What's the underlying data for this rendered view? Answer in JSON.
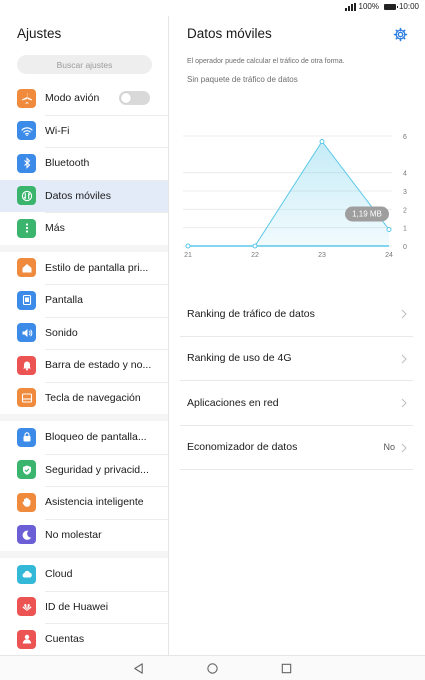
{
  "status": {
    "battery_text": "100%",
    "time": "10:00"
  },
  "left": {
    "title": "Ajustes",
    "search_placeholder": "Buscar ajustes",
    "groups": [
      [
        {
          "label": "Modo avión",
          "icon": "airplane-icon",
          "color": "#f08a3c",
          "toggle": "off"
        },
        {
          "label": "Wi-Fi",
          "icon": "wifi-icon",
          "color": "#3d8be8"
        },
        {
          "label": "Bluetooth",
          "icon": "bluetooth-icon",
          "color": "#3d8be8"
        },
        {
          "label": "Datos móviles",
          "icon": "mobile-data-icon",
          "color": "#3bb46e",
          "active": true
        },
        {
          "label": "Más",
          "icon": "more-icon",
          "color": "#3bb46e"
        }
      ],
      [
        {
          "label": "Estilo de pantalla pri...",
          "icon": "home-style-icon",
          "color": "#f08a3c"
        },
        {
          "label": "Pantalla",
          "icon": "display-icon",
          "color": "#3d8be8"
        },
        {
          "label": "Sonido",
          "icon": "sound-icon",
          "color": "#3d8be8"
        },
        {
          "label": "Barra de estado y no...",
          "icon": "notification-bell-icon",
          "color": "#ec5353"
        },
        {
          "label": "Tecla de navegación",
          "icon": "navigation-key-icon",
          "color": "#f08a3c"
        }
      ],
      [
        {
          "label": "Bloqueo de pantalla...",
          "icon": "lock-icon",
          "color": "#3d8be8"
        },
        {
          "label": "Seguridad y privacid...",
          "icon": "shield-icon",
          "color": "#3bb46e"
        },
        {
          "label": "Asistencia inteligente",
          "icon": "hand-icon",
          "color": "#f08a3c"
        },
        {
          "label": "No molestar",
          "icon": "moon-icon",
          "color": "#6c5fd6"
        }
      ],
      [
        {
          "label": "Cloud",
          "icon": "cloud-icon",
          "color": "#34b8d8"
        },
        {
          "label": "ID de Huawei",
          "icon": "huawei-icon",
          "color": "#ec5353"
        },
        {
          "label": "Cuentas",
          "icon": "account-icon",
          "color": "#ec5353"
        }
      ]
    ]
  },
  "right": {
    "title": "Datos móviles",
    "note1": "El operador puede calcular el tráfico de otra forma.",
    "note2": "Sin paquete de tráfico de datos",
    "menu": [
      {
        "label": "Ranking de tráfico de datos",
        "value": ""
      },
      {
        "label": "Ranking de uso de 4G",
        "value": ""
      },
      {
        "label": "Aplicaciones en red",
        "value": ""
      },
      {
        "label": "Economizador de datos",
        "value": "No"
      }
    ]
  },
  "chart_data": {
    "type": "area",
    "x": [
      "21",
      "22",
      "23",
      "24"
    ],
    "values": [
      0,
      0,
      5.7,
      0.9
    ],
    "y_ticks": [
      "0",
      "1",
      "2",
      "3",
      "4",
      "6"
    ],
    "ylim": [
      0,
      6
    ],
    "annotation": "1,19 MB",
    "accent": "#5ac8e8"
  }
}
